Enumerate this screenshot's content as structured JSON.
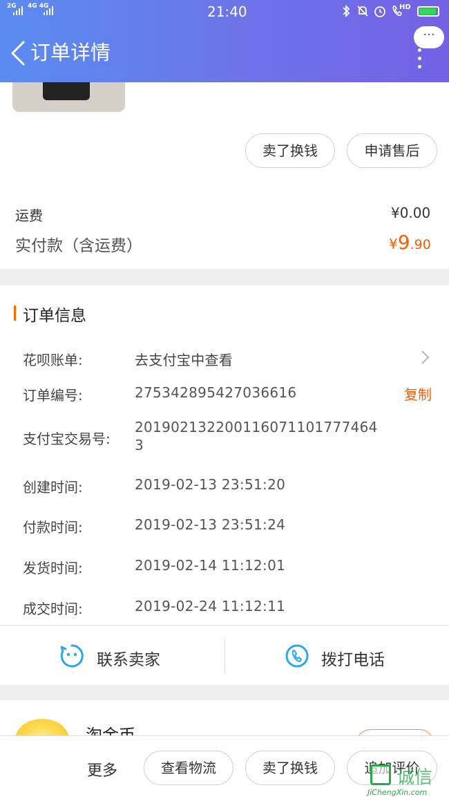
{
  "status_bar": {
    "signal_left": "2G",
    "signal_mid": "4G 4G",
    "time": "21:40",
    "hd": "HD"
  },
  "header": {
    "title": "订单详情",
    "more_label": "···"
  },
  "product_actions": {
    "sell_label": "卖了换钱",
    "after_sale_label": "申请售后"
  },
  "price": {
    "shipping_label": "运费",
    "shipping_value": "¥0.00",
    "paid_label": "实付款（含运费）",
    "paid_currency": "¥",
    "paid_int": "9",
    "paid_dec": ".90"
  },
  "order_info": {
    "section_title": "订单信息",
    "rows": [
      {
        "label": "花呗账单:",
        "value": "去支付宝中查看"
      },
      {
        "label": "订单编号:",
        "value": "275342895427036616",
        "action": "复制"
      },
      {
        "label": "支付宝交易号:",
        "value_line1": "20190213220011607110177746​4",
        "value_line2": "3"
      },
      {
        "label": "创建时间:",
        "value": "2019-02-13 23:51:20"
      },
      {
        "label": "付款时间:",
        "value": "2019-02-13 23:51:24"
      },
      {
        "label": "发货时间:",
        "value": "2019-02-14 11:12:01"
      },
      {
        "label": "成交时间:",
        "value": "2019-02-24 11:12:11"
      }
    ]
  },
  "contact": {
    "seller_label": "联系卖家",
    "call_label": "拨打电话"
  },
  "coin": {
    "title": "淘金币"
  },
  "bottom": {
    "more_label": "更多",
    "logistics_label": "查看物流",
    "sell_label": "卖了换钱",
    "review_label": "追加评价"
  },
  "watermark": {
    "brand": "JiChengXin.com",
    "cn": "诚信"
  },
  "colors": {
    "header_start": "#5a8cf0",
    "header_end": "#7362e4",
    "accent": "#ff5b00",
    "icon_blue": "#2da6f0"
  }
}
